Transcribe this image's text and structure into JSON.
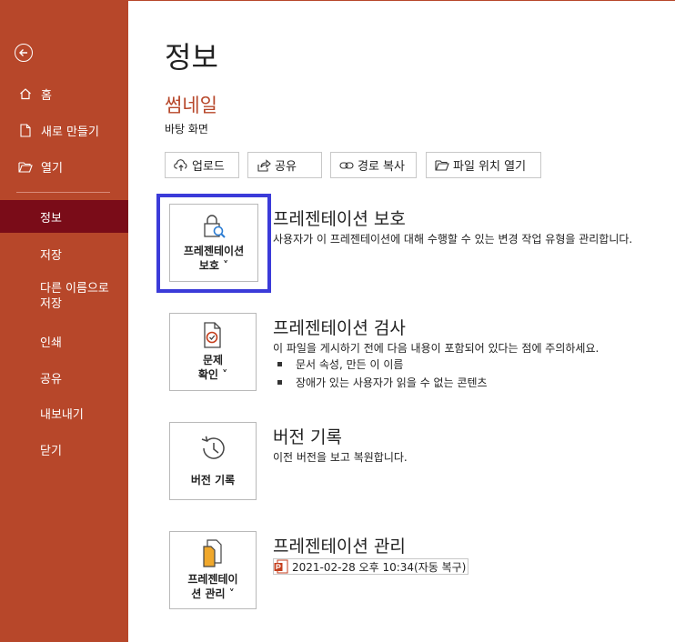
{
  "sidebar": {
    "items": [
      {
        "label": "홈"
      },
      {
        "label": "새로 만들기"
      },
      {
        "label": "열기"
      },
      {
        "label": "정보"
      },
      {
        "label": "저장"
      },
      {
        "label": "다른 이름으로 저장"
      },
      {
        "label": "인쇄"
      },
      {
        "label": "공유"
      },
      {
        "label": "내보내기"
      },
      {
        "label": "닫기"
      }
    ],
    "accent": "#b7472a",
    "active_bg": "#7a0c18"
  },
  "main": {
    "title": "정보",
    "thumb_title": "썸네일",
    "thumb_sub": "바탕 화면",
    "toolbar": {
      "upload": "업로드",
      "share": "공유",
      "copy_path": "경로 복사",
      "open_location": "파일 위치 열기"
    },
    "sections": {
      "protect": {
        "card_label": "프레젠테이션\n보호 ˅",
        "title": "프레젠테이션 보호",
        "desc": "사용자가 이 프레젠테이션에 대해 수행할 수 있는 변경 작업 유형을 관리합니다."
      },
      "inspect": {
        "card_label": "문제\n확인 ˅",
        "title": "프레젠테이션 검사",
        "desc": "이 파일을 게시하기 전에 다음 내용이 포함되어 있다는 점에 주의하세요.",
        "bullets": [
          "문서 속성, 만든 이 이름",
          "장애가 있는 사용자가 읽을 수 없는 콘텐츠"
        ]
      },
      "history": {
        "card_label": "버전 기록",
        "title": "버전 기록",
        "desc": "이전 버전을 보고 복원합니다."
      },
      "manage": {
        "card_label": "프레젠테이\n션 관리 ˅",
        "title": "프레젠테이션 관리",
        "version": "2021-02-28 오후 10:34(자동 복구)"
      }
    },
    "focus_color": "#3b3bd9"
  }
}
